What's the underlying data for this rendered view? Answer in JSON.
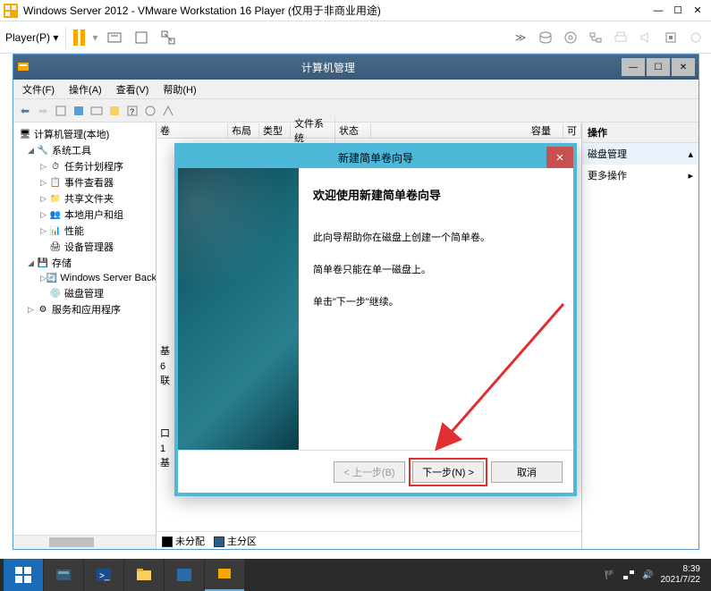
{
  "vmware": {
    "title": "Windows Server 2012 - VMware Workstation 16 Player (仅用于非商业用途)",
    "player_menu": "Player(P)"
  },
  "mgmt": {
    "title": "计算机管理",
    "menus": {
      "file": "文件(F)",
      "action": "操作(A)",
      "view": "查看(V)",
      "help": "帮助(H)"
    },
    "tree": {
      "root": "计算机管理(本地)",
      "system_tools": "系统工具",
      "task_scheduler": "任务计划程序",
      "event_viewer": "事件查看器",
      "shared_folders": "共享文件夹",
      "local_users": "本地用户和组",
      "performance": "性能",
      "device_manager": "设备管理器",
      "storage": "存储",
      "wsb": "Windows Server Back",
      "disk_mgmt": "磁盘管理",
      "services_apps": "服务和应用程序"
    },
    "columns": {
      "volume": "卷",
      "layout": "布局",
      "type": "类型",
      "fs": "文件系统",
      "status": "状态",
      "capacity": "容量",
      "free": "可"
    },
    "legend": {
      "unallocated": "未分配",
      "primary": "主分区"
    },
    "disk_labels": {
      "basic": "基",
      "size": "6",
      "online": "联"
    },
    "actions": {
      "header": "操作",
      "disk_mgmt": "磁盘管理",
      "more": "更多操作"
    }
  },
  "wizard": {
    "title": "新建简单卷向导",
    "heading": "欢迎使用新建简单卷向导",
    "line1": "此向导帮助你在磁盘上创建一个简单卷。",
    "line2": "简单卷只能在单一磁盘上。",
    "line3": "单击\"下一步\"继续。",
    "btn_back": "< 上一步(B)",
    "btn_next": "下一步(N) >",
    "btn_cancel": "取消"
  },
  "taskbar": {
    "time": "8:39",
    "date": "2021/7/22"
  }
}
